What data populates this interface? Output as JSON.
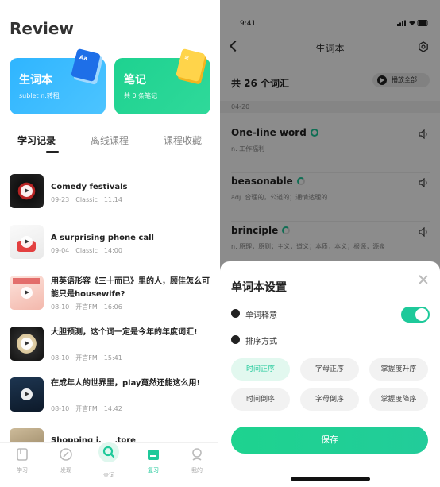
{
  "left": {
    "title": "Review",
    "cards": [
      {
        "title": "生词本",
        "subtitle": "sublet n.转租",
        "deco_text": "Aa"
      },
      {
        "title": "笔记",
        "subtitle": "共 0 条笔记",
        "deco_text": "≡"
      }
    ],
    "tabs": [
      "学习记录",
      "离线课程",
      "课程收藏"
    ],
    "active_tab": 0,
    "items": [
      {
        "title": "Comedy festivals",
        "date": "09-23",
        "source": "Classic",
        "duration": "11:14"
      },
      {
        "title": "A surprising phone call",
        "date": "09-04",
        "source": "Classic",
        "duration": "14:00"
      },
      {
        "title": "用英语形容《三十而已》里的人，顾佳怎么可能只是housewife?",
        "date": "08-10",
        "source": "开言FM",
        "duration": "16:06"
      },
      {
        "title": "大胆预测，这个词一定是今年的年度词汇!",
        "date": "08-10",
        "source": "开言FM",
        "duration": "15:41"
      },
      {
        "title": "在成年人的世界里，play竟然还能这么用!",
        "date": "08-10",
        "source": "开言FM",
        "duration": "14:42"
      },
      {
        "title": "Shopping i… …tore",
        "date": "",
        "source": "",
        "duration": ""
      }
    ],
    "tabbar": [
      "学习",
      "发现",
      "查词",
      "复习",
      "我的"
    ],
    "active_tabbar": 3
  },
  "right": {
    "time": "9:41",
    "nav_title": "生词本",
    "count_text": "共 26 个词汇",
    "play_all": "播放全部",
    "date_header": "04-20",
    "words": [
      {
        "word": "One-line word",
        "def": "n. 工作福利",
        "ring": "full"
      },
      {
        "word": "beasonable",
        "def": "adj. 合理的，公道的；通情达理的",
        "ring": "partial"
      },
      {
        "word": "brinciple",
        "def": "n. 原理，原则；主义，道义；本质，本义；根源，源泉",
        "ring": "partial"
      }
    ],
    "sheet": {
      "title": "单词本设置",
      "meaning_label": "单词释意",
      "meaning_on": true,
      "sort_label": "排序方式",
      "sort_options": [
        "时间正序",
        "字母正序",
        "掌握度升序",
        "时间倒序",
        "字母倒序",
        "掌握度降序"
      ],
      "selected_sort": 0,
      "save": "保存"
    }
  },
  "colors": {
    "accent": "#1ec99a",
    "blue_card": "#2fb5ff",
    "green_card": "#1ed290"
  }
}
